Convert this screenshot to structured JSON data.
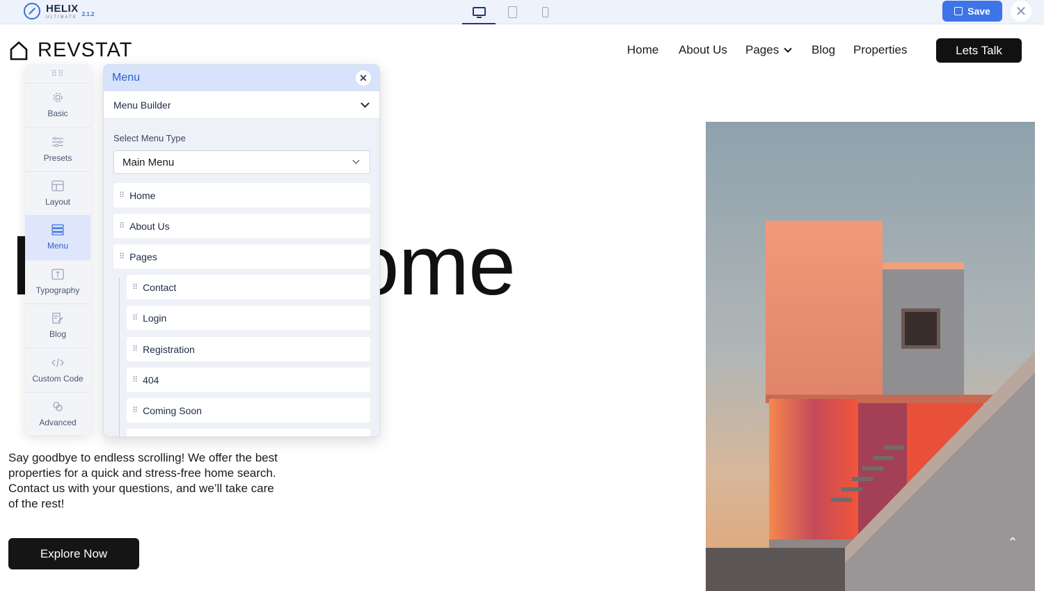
{
  "editor": {
    "logo_name": "HELIX",
    "logo_sub": "ULTIMATE",
    "version": "2.1.2",
    "devices": [
      "desktop-icon",
      "tablet-icon",
      "mobile-icon"
    ],
    "save_label": "Save",
    "accent_color": "#3d74e8"
  },
  "site": {
    "brand": "REVSTAT",
    "nav": [
      "Home",
      "About Us",
      "Pages",
      "Blog",
      "Properties"
    ],
    "cta": "Lets Talk",
    "hero_title": "F       n Home",
    "hero_text": "Say goodbye to endless scrolling! We offer the best properties for a quick and stress-free home search. Contact us with your questions, and we’ll take care of the rest!",
    "explore": "Explore Now"
  },
  "sidebar": {
    "items": [
      {
        "label": "Basic",
        "icon": "gear-icon"
      },
      {
        "label": "Presets",
        "icon": "sliders-icon"
      },
      {
        "label": "Layout",
        "icon": "layout-icon"
      },
      {
        "label": "Menu",
        "icon": "menu-icon",
        "active": true
      },
      {
        "label": "Typography",
        "icon": "typography-icon"
      },
      {
        "label": "Blog",
        "icon": "blog-icon"
      },
      {
        "label": "Custom Code",
        "icon": "code-icon"
      },
      {
        "label": "Advanced",
        "icon": "advanced-icon"
      }
    ]
  },
  "panel": {
    "title": "Menu",
    "section": "Menu Builder",
    "type_label": "Select Menu Type",
    "type_value": "Main Menu",
    "items": [
      {
        "label": "Home",
        "level": 0
      },
      {
        "label": "About Us",
        "level": 0
      },
      {
        "label": "Pages",
        "level": 0
      },
      {
        "label": "Contact",
        "level": 1
      },
      {
        "label": "Login",
        "level": 1
      },
      {
        "label": "Registration",
        "level": 1
      },
      {
        "label": "404",
        "level": 1
      },
      {
        "label": "Coming Soon",
        "level": 1
      }
    ]
  }
}
